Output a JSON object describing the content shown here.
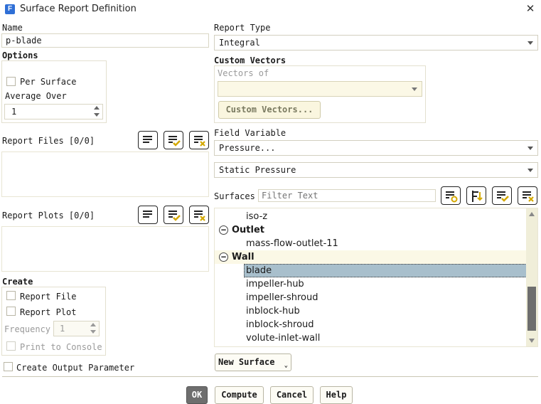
{
  "window": {
    "title": "Surface Report Definition",
    "icon_letter": "F"
  },
  "left": {
    "name_label": "Name",
    "name_value": "p-blade",
    "options_label": "Options",
    "per_surface_label": "Per Surface",
    "average_over_label": "Average Over",
    "average_over_value": "1",
    "report_files_label": "Report Files [0/0]",
    "report_plots_label": "Report Plots [0/0]",
    "create_label": "Create",
    "report_file_label": "Report File",
    "report_plot_label": "Report Plot",
    "frequency_label": "Frequency",
    "frequency_value": "1",
    "print_to_console_label": "Print to Console",
    "create_output_param_label": "Create Output Parameter"
  },
  "right": {
    "report_type_label": "Report Type",
    "report_type_value": "Integral",
    "custom_vectors_label": "Custom Vectors",
    "vectors_of_label": "Vectors of",
    "vectors_of_value": "",
    "custom_vectors_button": "Custom Vectors...",
    "field_variable_label": "Field Variable",
    "field_variable_value": "Pressure...",
    "field_sub_value": "Static Pressure",
    "surfaces_label": "Surfaces",
    "filter_placeholder": "Filter Text",
    "surfaces_tree": [
      {
        "text": "iso-z",
        "kind": "item"
      },
      {
        "text": "Outlet",
        "kind": "group"
      },
      {
        "text": "mass-flow-outlet-11",
        "kind": "item"
      },
      {
        "text": "Wall",
        "kind": "group"
      },
      {
        "text": "blade",
        "kind": "item",
        "selected": true
      },
      {
        "text": "impeller-hub",
        "kind": "item"
      },
      {
        "text": "impeller-shroud",
        "kind": "item"
      },
      {
        "text": "inblock-hub",
        "kind": "item"
      },
      {
        "text": "inblock-shroud",
        "kind": "item"
      },
      {
        "text": "volute-inlet-wall",
        "kind": "item"
      }
    ],
    "new_surface_button": "New Surface"
  },
  "footer": {
    "ok": "OK",
    "compute": "Compute",
    "cancel": "Cancel",
    "help": "Help"
  },
  "colors": {
    "selection": "#a8bfcc",
    "group_highlight": "#fbf8e6",
    "scrollbar_thumb": "#6e6e6e"
  }
}
